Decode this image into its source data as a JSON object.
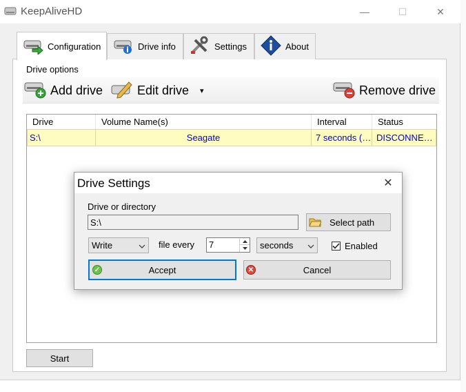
{
  "window": {
    "title": "KeepAliveHD",
    "minimize": "—",
    "maximize": "☐",
    "close": "✕"
  },
  "tabs": [
    {
      "label": "Configuration",
      "icon": "drive-arrow-icon"
    },
    {
      "label": "Drive info",
      "icon": "drive-info-icon"
    },
    {
      "label": "Settings",
      "icon": "tools-icon"
    },
    {
      "label": "About",
      "icon": "info-icon"
    }
  ],
  "config": {
    "drive_options_label": "Drive options",
    "toolbar": {
      "add_label": "Add drive",
      "edit_label": "Edit drive",
      "remove_label": "Remove drive",
      "dropdown_arrow": "▾"
    },
    "list": {
      "columns": [
        "Drive",
        "Volume Name(s)",
        "Interval",
        "Status"
      ],
      "rows": [
        [
          "S:\\",
          "Seagate",
          "7 seconds (…",
          "DISCONNE…"
        ]
      ]
    },
    "start_label": "Start"
  },
  "dialog": {
    "title": "Drive Settings",
    "close": "✕",
    "path_label": "Drive or directory",
    "path_value": "S:\\",
    "select_path_label": "Select path",
    "action_value": "Write",
    "file_every_label": "file every",
    "interval_value": "7",
    "unit_value": "seconds",
    "enabled_label": "Enabled",
    "enabled_checked": true,
    "accept_label": "Accept",
    "cancel_label": "Cancel"
  },
  "colors": {
    "selected_row_bg": "#fffcc0",
    "row_text": "#0000cc",
    "accept_border": "#0078d7"
  }
}
